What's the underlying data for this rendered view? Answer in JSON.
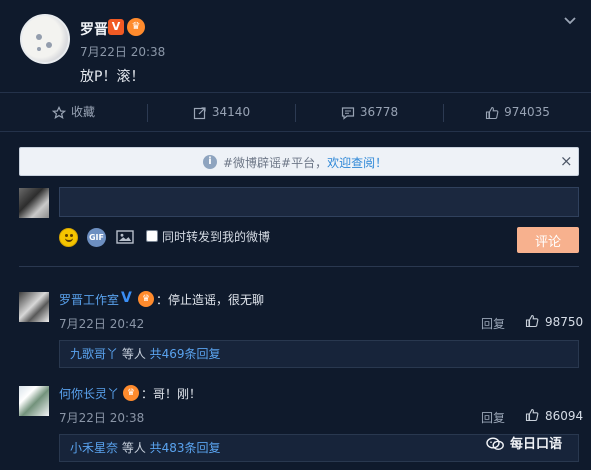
{
  "post": {
    "author": "罗晋",
    "verified_mark": "V",
    "time": "7月22日 20:38",
    "text": "放P！滚！"
  },
  "actions": [
    {
      "label": "收藏",
      "icon": "star-icon"
    },
    {
      "label": "34140",
      "icon": "repost-icon"
    },
    {
      "label": "36778",
      "icon": "comment-icon"
    },
    {
      "label": "974035",
      "icon": "like-icon"
    }
  ],
  "notice": {
    "text": "#微博辟谣#平台，",
    "link": "欢迎查阅！"
  },
  "composer": {
    "placeholder": "",
    "repost_label": "同时转发到我的微博",
    "submit_label": "评论"
  },
  "comments": [
    {
      "name": "罗晋工作室",
      "text": "：停止造谣，很无聊",
      "time": "7月22日 20:42",
      "reply_label": "回复",
      "likes": "98750",
      "reply_from": "九歌哥丫",
      "reply_mid": " 等人 ",
      "reply_count": "共469条回复"
    },
    {
      "name": "何你长灵丫",
      "text": "：哥！刚！",
      "time": "7月22日 20:38",
      "reply_label": "回复",
      "likes": "86094",
      "reply_from": "小禾星奈",
      "reply_mid": " 等人 ",
      "reply_count": "共483条回复"
    }
  ],
  "watermark": {
    "text": "每日口语"
  },
  "colors": {
    "background": "#0f1a2c",
    "link": "#5aa3ef",
    "submit": "#f7b18e",
    "verified": "#f15a24"
  }
}
